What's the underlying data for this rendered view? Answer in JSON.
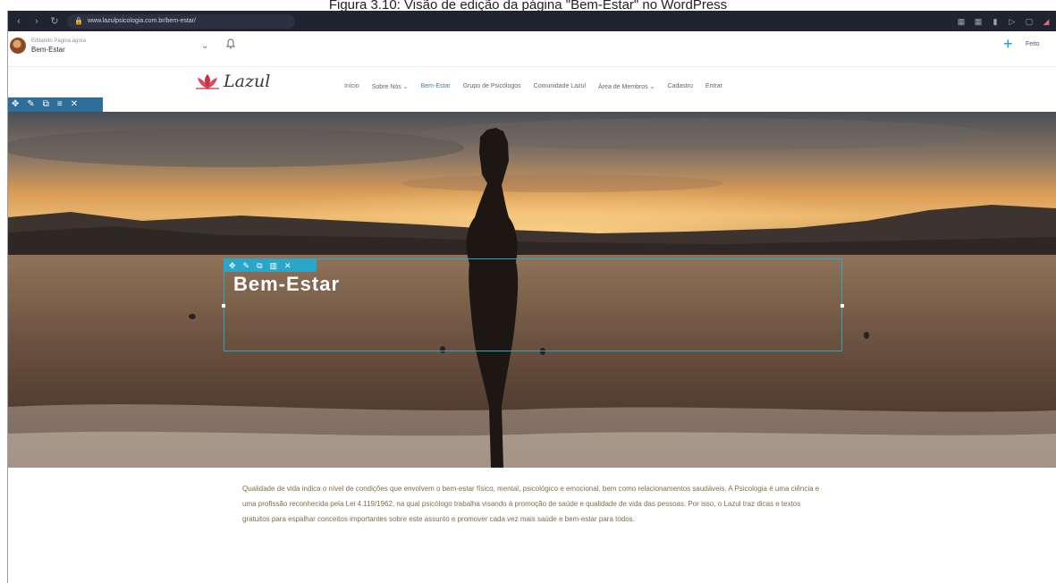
{
  "caption": "Figura 3.10: Visão de edição da página \"Bem-Estar\" no WordPress",
  "browser": {
    "url": "www.lazulpsicologia.com.br/bem-estar/",
    "icons": [
      "back-icon",
      "forward-icon",
      "reload-icon",
      "lock-icon"
    ]
  },
  "admin_bar": {
    "edit_label": "Editando Página agora",
    "page_name": "Bem-Estar",
    "publish_label": "Feito",
    "accent": "#1e90e8"
  },
  "site": {
    "logo_text": "Lazul",
    "nav": [
      "Início",
      "Sobre Nós ⌄",
      "Bem-Estar",
      "Grupo de Psicólogos",
      "Comunidade Lazul",
      "Área de Membros ⌄",
      "Cadastro",
      "Entrar"
    ],
    "active_nav": "Bem-Estar",
    "nav_active_color": "#4a7ea3"
  },
  "hero": {
    "title": "Bem-Estar",
    "selection_color": "#2aa6c9"
  },
  "body": {
    "paragraph": "Qualidade de vida indica o nível de condições que envolvem o bem-estar físico, mental, psicológico e emocional, bem como relacionamentos saudáveis. A Psicologia é uma ciência e uma profissão reconhecida pela Lei 4.119/1962, na qual psicólogo trabalha visando à promoção de saúde e qualidade de vida das pessoas. Por isso, o Lazul traz dicas e textos gratuitos para espalhar conceitos importantes sobre este assunto e promover cada vez mais saúde e bem-estar para todos."
  }
}
